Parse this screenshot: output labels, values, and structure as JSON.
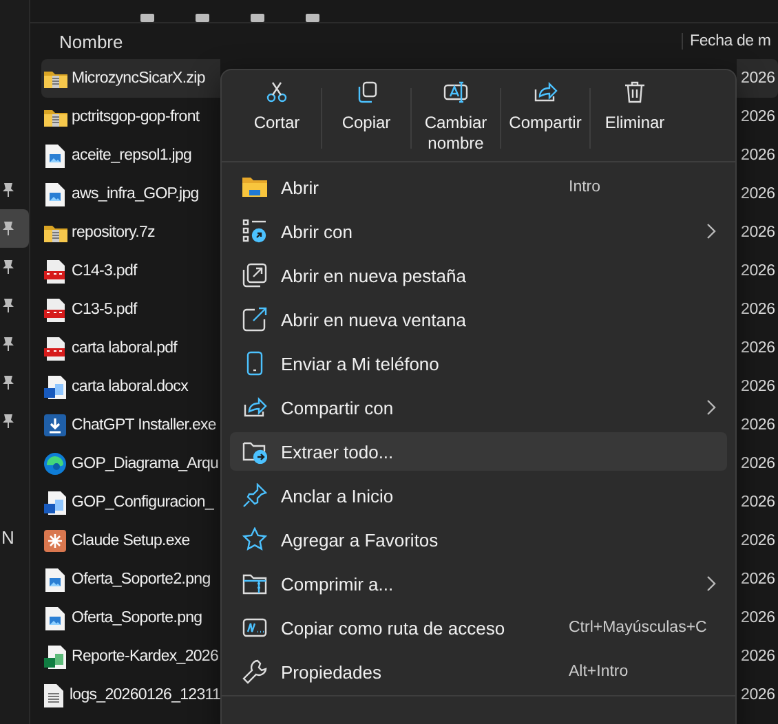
{
  "nav_pane": {
    "items": [
      {
        "kind": "pin",
        "selected": false
      },
      {
        "kind": "pin",
        "selected": true
      },
      {
        "kind": "pin",
        "selected": false
      },
      {
        "kind": "pin",
        "selected": false
      },
      {
        "kind": "pin",
        "selected": false
      },
      {
        "kind": "pin",
        "selected": false
      },
      {
        "kind": "pin",
        "selected": false
      },
      {
        "kind": "label",
        "label": "N",
        "selected": false
      }
    ]
  },
  "file_list": {
    "columns": [
      "Nombre",
      "Fecha de m"
    ],
    "rows": [
      {
        "name": "MicrozyncSicarX.zip",
        "kind": "zip",
        "date": "2026",
        "selected": true
      },
      {
        "name": "pctritsgop-gop-front",
        "kind": "zip",
        "date": "2026",
        "selected": false
      },
      {
        "name": "aceite_repsol1.jpg",
        "kind": "image",
        "date": "2026",
        "selected": false
      },
      {
        "name": "aws_infra_GOP.jpg",
        "kind": "image",
        "date": "2026",
        "selected": false
      },
      {
        "name": "repository.7z",
        "kind": "zip",
        "date": "2026",
        "selected": false
      },
      {
        "name": "C14-3.pdf",
        "kind": "pdf",
        "date": "2026",
        "selected": false
      },
      {
        "name": "C13-5.pdf",
        "kind": "pdf",
        "date": "2026",
        "selected": false
      },
      {
        "name": "carta laboral.pdf",
        "kind": "pdf",
        "date": "2026",
        "selected": false
      },
      {
        "name": "carta laboral.docx",
        "kind": "word",
        "date": "2026",
        "selected": false
      },
      {
        "name": "ChatGPT Installer.exe",
        "kind": "installer",
        "date": "2026",
        "selected": false
      },
      {
        "name": "GOP_Diagrama_Arqu",
        "kind": "edge",
        "date": "2026",
        "selected": false
      },
      {
        "name": "GOP_Configuracion_",
        "kind": "word",
        "date": "2026",
        "selected": false
      },
      {
        "name": "Claude Setup.exe",
        "kind": "setup",
        "date": "2026",
        "selected": false
      },
      {
        "name": "Oferta_Soporte2.png",
        "kind": "image",
        "date": "2026",
        "selected": false
      },
      {
        "name": "Oferta_Soporte.png",
        "kind": "image",
        "date": "2026",
        "selected": false
      },
      {
        "name": "Reporte-Kardex_2026",
        "kind": "excel",
        "date": "2026",
        "selected": false
      },
      {
        "name": "logs_20260126_12311",
        "kind": "text",
        "date": "2026",
        "selected": false
      }
    ]
  },
  "context_menu": {
    "actions": [
      {
        "label": "Cortar"
      },
      {
        "label": "Copiar"
      },
      {
        "label": "Cambiar nombre"
      },
      {
        "label": "Compartir"
      },
      {
        "label": "Eliminar"
      }
    ],
    "items": [
      {
        "label": "Abrir",
        "shortcut": "Intro",
        "submenu": false,
        "selected": false
      },
      {
        "label": "Abrir con",
        "submenu": true,
        "selected": false
      },
      {
        "label": "Abrir en nueva pestaña",
        "submenu": false,
        "selected": false
      },
      {
        "label": "Abrir en nueva ventana",
        "submenu": false,
        "selected": false
      },
      {
        "label": "Enviar a Mi teléfono",
        "submenu": false,
        "selected": false
      },
      {
        "label": "Compartir con",
        "submenu": true,
        "selected": false
      },
      {
        "label": "Extraer todo...",
        "submenu": false,
        "selected": true
      },
      {
        "label": "Anclar a Inicio",
        "submenu": false,
        "selected": false
      },
      {
        "label": "Agregar a Favoritos",
        "submenu": false,
        "selected": false
      },
      {
        "label": "Comprimir a...",
        "submenu": true,
        "selected": false
      },
      {
        "label": "Copiar como ruta de acceso",
        "shortcut": "Ctrl+Mayúsculas+C",
        "submenu": false,
        "selected": false
      },
      {
        "label": "Propiedades",
        "shortcut": "Alt+Intro",
        "submenu": false,
        "selected": false
      }
    ]
  }
}
